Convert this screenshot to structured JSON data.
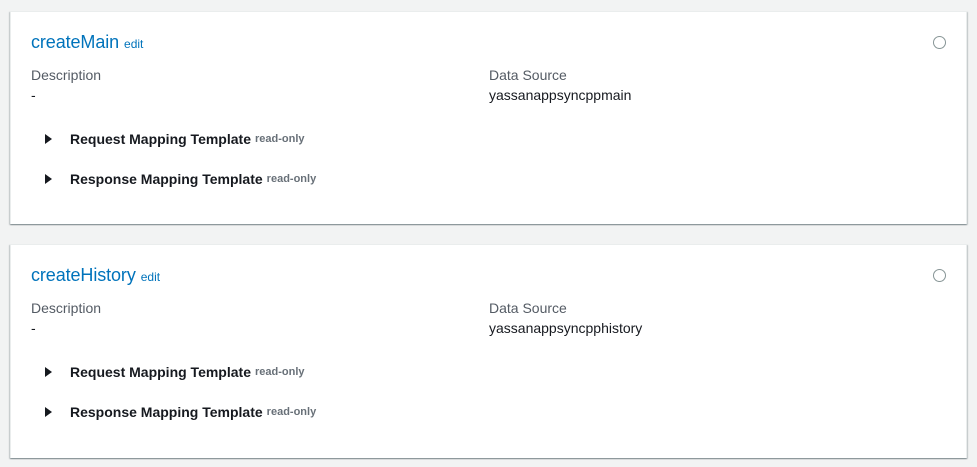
{
  "resolvers": [
    {
      "name": "createMain",
      "edit_label": "edit",
      "description_label": "Description",
      "description_value": "-",
      "datasource_label": "Data Source",
      "datasource_value": "yassanappsyncppmain",
      "request_label": "Request Mapping Template",
      "request_badge": "read-only",
      "response_label": "Response Mapping Template",
      "response_badge": "read-only"
    },
    {
      "name": "createHistory",
      "edit_label": "edit",
      "description_label": "Description",
      "description_value": "-",
      "datasource_label": "Data Source",
      "datasource_value": "yassanappsyncpphistory",
      "request_label": "Request Mapping Template",
      "request_badge": "read-only",
      "response_label": "Response Mapping Template",
      "response_badge": "read-only"
    }
  ],
  "colors": {
    "link": "#0073bb",
    "background": "#f2f3f3",
    "card": "#ffffff",
    "label": "#545b64",
    "badge": "#687078"
  }
}
